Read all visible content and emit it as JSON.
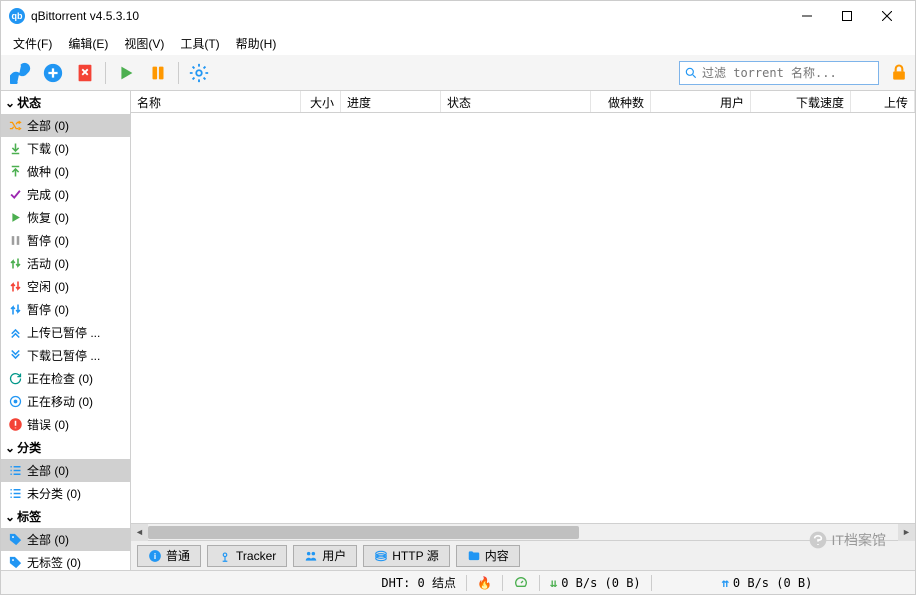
{
  "window": {
    "title": "qBittorrent v4.5.3.10"
  },
  "menu": {
    "file": "文件(F)",
    "edit": "编辑(E)",
    "view": "视图(V)",
    "tools": "工具(T)",
    "help": "帮助(H)"
  },
  "search": {
    "placeholder": "过滤 torrent 名称..."
  },
  "sidebar": {
    "status_header": "状态",
    "status_items": [
      {
        "label": "全部 (0)",
        "color": "#ff9800",
        "selected": true,
        "icon": "shuffle"
      },
      {
        "label": "下载 (0)",
        "color": "#4caf50",
        "icon": "down"
      },
      {
        "label": "做种 (0)",
        "color": "#4caf50",
        "icon": "up"
      },
      {
        "label": "完成 (0)",
        "color": "#9c27b0",
        "icon": "check"
      },
      {
        "label": "恢复 (0)",
        "color": "#4caf50",
        "icon": "play"
      },
      {
        "label": "暂停 (0)",
        "color": "#9e9e9e",
        "icon": "pause"
      },
      {
        "label": "活动 (0)",
        "color": "#4caf50",
        "icon": "updown"
      },
      {
        "label": "空闲 (0)",
        "color": "#f44336",
        "icon": "updown"
      },
      {
        "label": "暂停 (0)",
        "color": "#2196f3",
        "icon": "updown"
      },
      {
        "label": "上传已暂停 ...",
        "color": "#2196f3",
        "icon": "upchev"
      },
      {
        "label": "下载已暂停 ...",
        "color": "#2196f3",
        "icon": "downchev"
      },
      {
        "label": "正在检查 (0)",
        "color": "#009688",
        "icon": "refresh"
      },
      {
        "label": "正在移动 (0)",
        "color": "#2196f3",
        "icon": "target"
      },
      {
        "label": "错误 (0)",
        "color": "#f44336",
        "icon": "error"
      }
    ],
    "category_header": "分类",
    "category_items": [
      {
        "label": "全部 (0)",
        "selected": true
      },
      {
        "label": "未分类 (0)"
      }
    ],
    "tag_header": "标签",
    "tag_items": [
      {
        "label": "全部 (0)",
        "selected": true
      },
      {
        "label": "无标签 (0)"
      }
    ]
  },
  "columns": {
    "name": "名称",
    "size": "大小",
    "progress": "进度",
    "status": "状态",
    "seeds": "做种数",
    "peers": "用户",
    "dlspeed": "下载速度",
    "upspeed": "上传"
  },
  "tabs": {
    "general": "普通",
    "tracker": "Tracker",
    "peers": "用户",
    "http": "HTTP 源",
    "content": "内容"
  },
  "status": {
    "dht": "DHT: 0 结点",
    "dl": "0 B/s (0 B)",
    "ul": "0 B/s (0 B)"
  },
  "watermark": "IT档案馆"
}
